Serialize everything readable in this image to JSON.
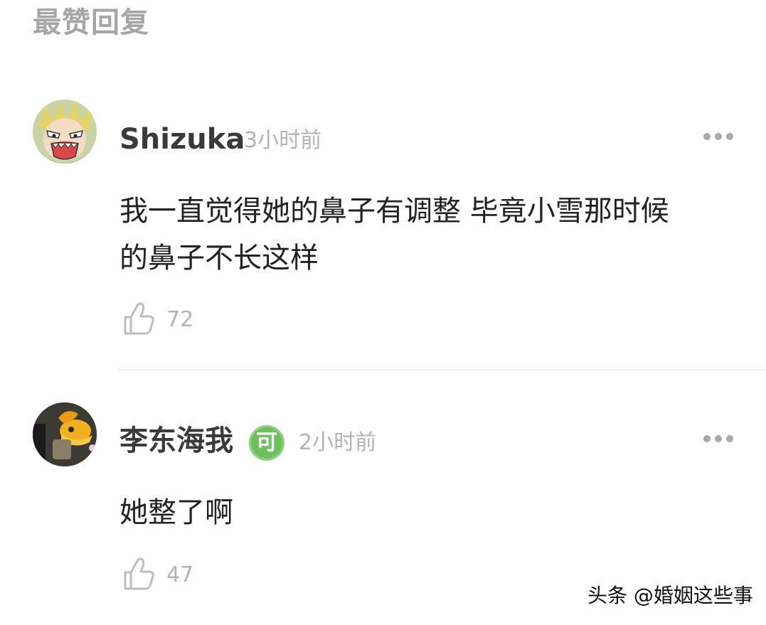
{
  "section": {
    "title": "最赞回复"
  },
  "comments": [
    {
      "username": "Shizuka",
      "badge": "",
      "time": "3小时前",
      "text_lines": [
        "我一直觉得她的鼻子有调整 毕竟小雪那时候",
        "的鼻子不长这样"
      ],
      "likes": "72",
      "avatar_icon": "anime-character-avatar",
      "more_icon": "more-dots-icon",
      "like_icon": "thumbs-up-icon"
    },
    {
      "username": "李东海我",
      "badge": "可",
      "time": "2小时前",
      "text_lines": [
        "她整了啊"
      ],
      "likes": "47",
      "avatar_icon": "yellow-figure-avatar",
      "more_icon": "more-dots-icon",
      "like_icon": "thumbs-up-icon"
    }
  ],
  "watermark": {
    "text": "头条 @婚姻这些事"
  },
  "colors": {
    "title": "#a6a6a6",
    "username": "#3a3a3a",
    "meta": "#b3b3b3",
    "badge": "#6fbf5f",
    "divider": "#ececec"
  }
}
